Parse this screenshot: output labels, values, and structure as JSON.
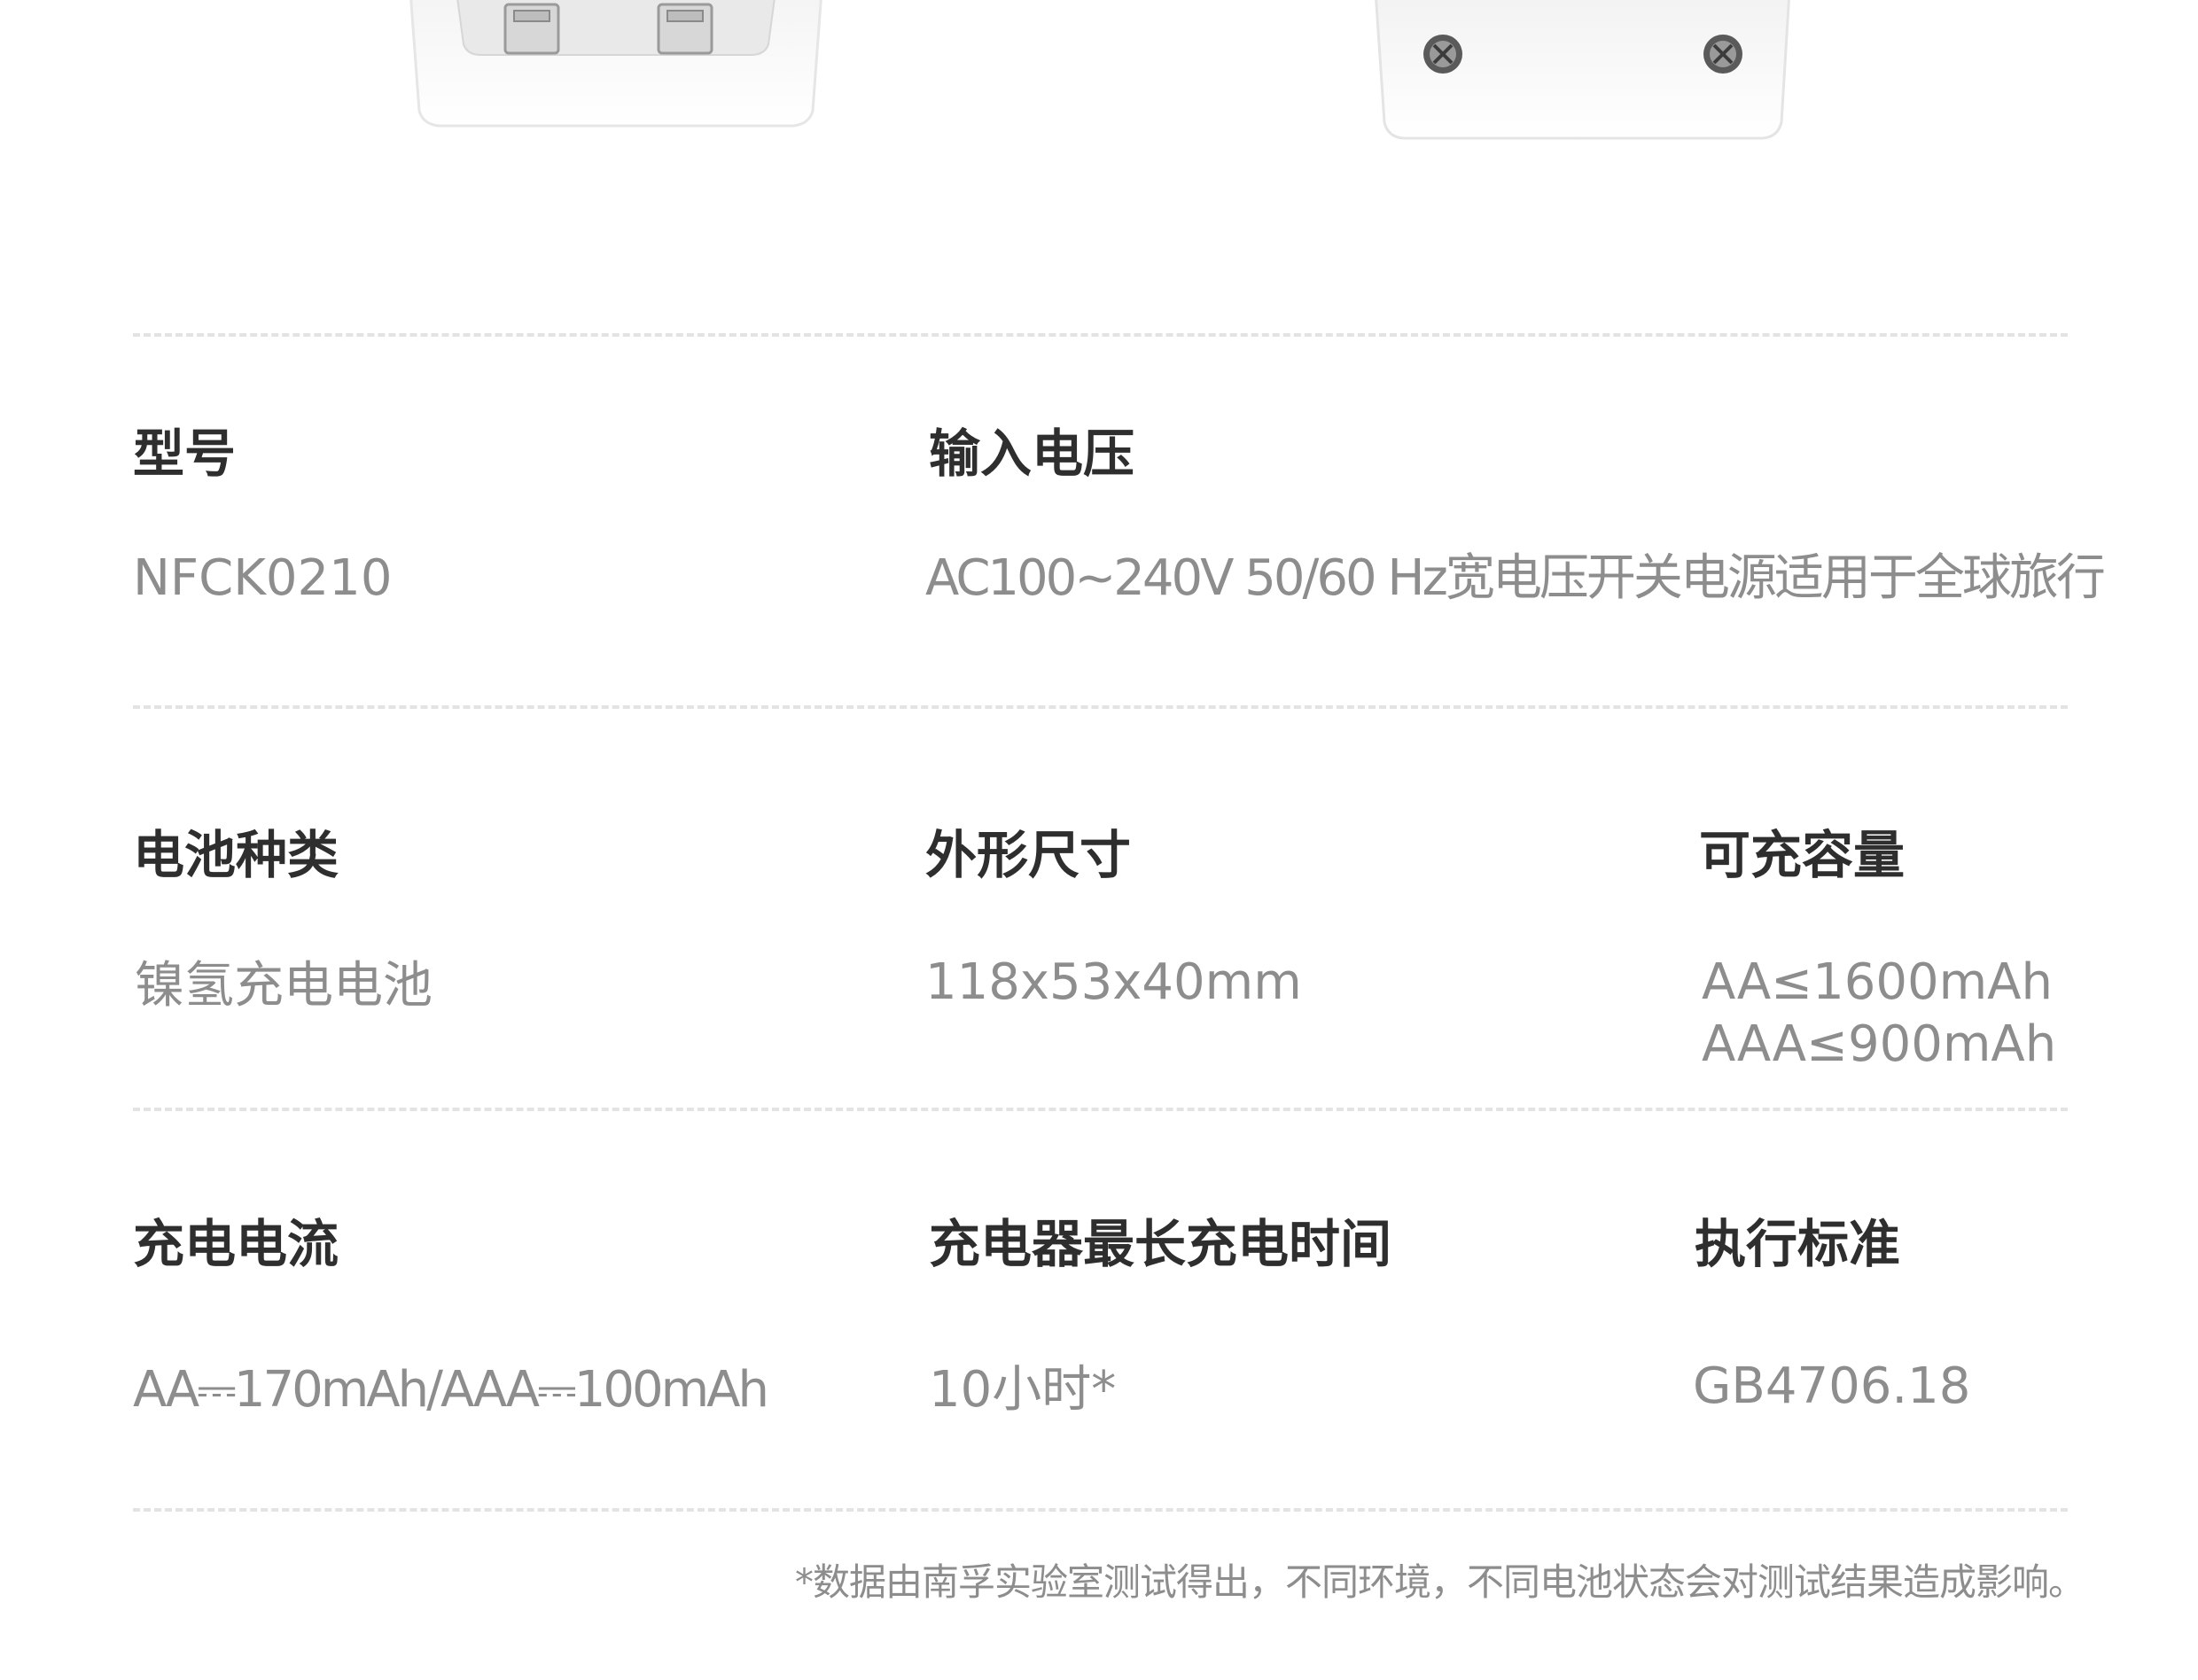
{
  "specs": {
    "model": {
      "label": "型号",
      "value": "NFCK0210"
    },
    "input_voltage": {
      "label": "输入电压",
      "value": "AC100~240V   50/60 Hz宽电压开关电源适用于全球旅行"
    },
    "battery_type": {
      "label": "电池种类",
      "value": "镍氢充电电池"
    },
    "dimensions": {
      "label": "外形尺寸",
      "value": "118x53x40mm"
    },
    "capacity": {
      "label": "可充容量",
      "value_line1": "AA≤1600mAh",
      "value_line2": "AAA≤900mAh"
    },
    "charge_current": {
      "label": "充电电流",
      "value": "AA⎓170mAh/AAA⎓100mAh"
    },
    "max_charge_time": {
      "label": "充电器最长充电时间",
      "value": "10小时*"
    },
    "standard": {
      "label": "执行标准",
      "value": "GB4706.18"
    }
  },
  "footnote": "*数据由南孚实验室测试得出，不同环境，不同电池状态会对测试结果造成影响。"
}
